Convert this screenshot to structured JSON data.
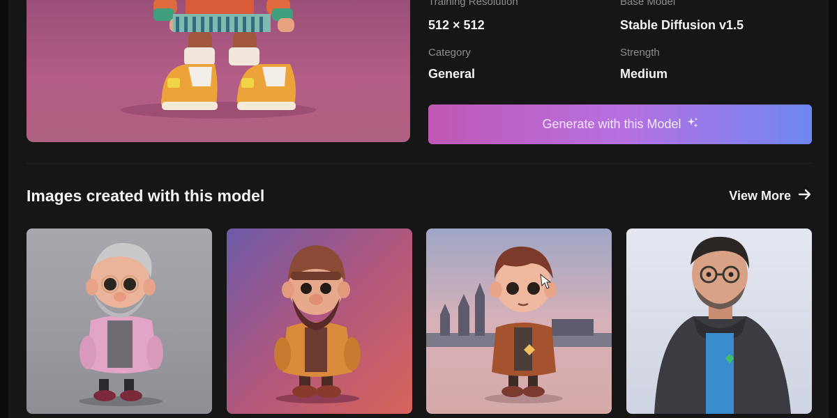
{
  "model_details": {
    "training_resolution": {
      "label": "Training Resolution",
      "value": "512 × 512"
    },
    "base_model": {
      "label": "Base Model",
      "value": "Stable Diffusion v1.5"
    },
    "category": {
      "label": "Category",
      "value": "General"
    },
    "strength": {
      "label": "Strength",
      "value": "Medium"
    }
  },
  "generate_button": {
    "label": "Generate with this Model",
    "icon": "sparkle-icon"
  },
  "gallery": {
    "title": "Images created with this model",
    "view_more": "View More",
    "view_more_icon": "arrow-right-icon",
    "images": [
      {
        "subject": "elderly man with grey beard in pink jacket"
      },
      {
        "subject": "bearded dwarf in leather cap and orange jacket"
      },
      {
        "subject": "boy in brown jacket in front of castle"
      },
      {
        "subject": "man with glasses in dark hoodie"
      }
    ]
  },
  "colors": {
    "background": "#161617",
    "accent_gradient_start": "#c058b4",
    "accent_gradient_end": "#6f86f2"
  }
}
